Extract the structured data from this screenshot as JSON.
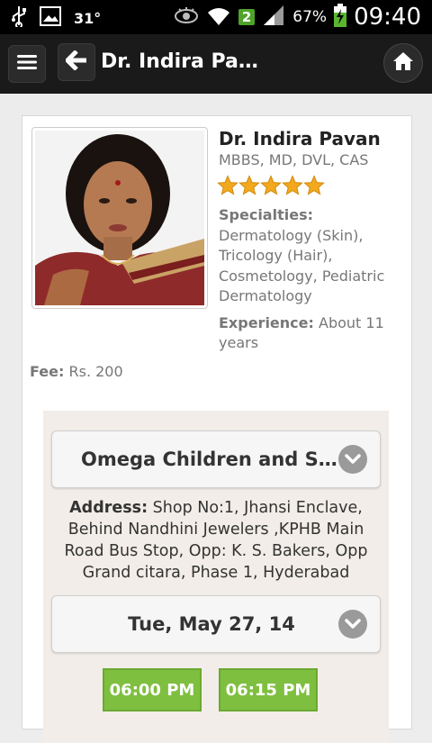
{
  "status_bar": {
    "temperature": "31°",
    "wifi_badge": "2",
    "battery_percent": "67%",
    "time": "09:40"
  },
  "action_bar": {
    "title": "Dr. Indira Pa…"
  },
  "doctor": {
    "name": "Dr. Indira Pavan",
    "qualifications": "MBBS, MD, DVL, CAS",
    "rating": 5,
    "rating_max": 5,
    "specialties_label": "Specialties:",
    "specialties_value": "Dermatology (Skin), Tricology (Hair), Cosmetology, Pediatric Dermatology",
    "experience_label": "Experience:",
    "experience_value": "About 11 years",
    "fee_label": "Fee:",
    "fee_value": "Rs. 200"
  },
  "clinic": {
    "selected_clinic": "Omega Children and Skin Clinic",
    "address_label": "Address:",
    "address_value": "Shop No:1, Jhansi Enclave, Behind Nandhini Jewelers ,KPHB Main Road Bus Stop, Opp: K. S. Bakers, Opp Grand citara, Phase 1, Hyderabad",
    "selected_date": "Tue, May 27, 14",
    "time_slots": [
      "06:00 PM",
      "06:15 PM"
    ]
  },
  "colors": {
    "slot_green": "#7fbf3f",
    "star_gold": "#f2a91d",
    "action_bar_bg": "#1a1a1a"
  }
}
